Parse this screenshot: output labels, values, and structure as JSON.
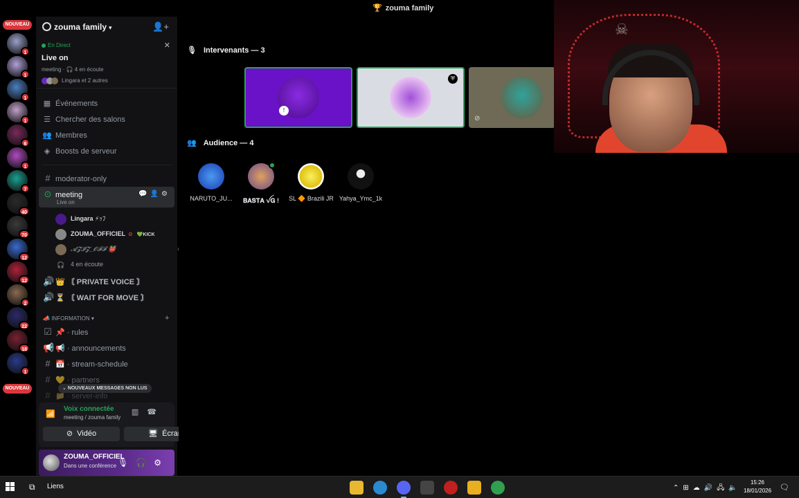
{
  "window": {
    "title": "zouma family",
    "title_icon": "trophy-icon"
  },
  "rail": {
    "top_badge": "NOUVEAU",
    "bottom_badge": "NOUVEAU",
    "servers": [
      {
        "badge": "1",
        "color": "#9aa0c8"
      },
      {
        "badge": "1",
        "color": "#b0a0d8"
      },
      {
        "badge": "1",
        "color": "#4a7fc1"
      },
      {
        "badge": "1",
        "color": "#c0a0c8"
      },
      {
        "badge": "6",
        "color": "#7a2a5a"
      },
      {
        "badge": "1",
        "color": "#b04ac0"
      },
      {
        "badge": "7",
        "color": "#1aa090"
      },
      {
        "badge": "40",
        "color": "#2a2a2a"
      },
      {
        "badge": "70",
        "color": "#3a3a3a"
      },
      {
        "badge": "12",
        "color": "#3a6ad0"
      },
      {
        "badge": "12",
        "color": "#b0203a"
      },
      {
        "badge": "2",
        "color": "#8a6a50"
      },
      {
        "badge": "22",
        "color": "#2a2a6a"
      },
      {
        "badge": "18",
        "color": "#7a2030"
      },
      {
        "badge": "1",
        "color": "#2a3a8a"
      }
    ]
  },
  "sidebar": {
    "server_name": "zouma family",
    "live": {
      "status": "En Direct",
      "title": "Live on",
      "meta": "meeting · 🎧 4 en écoute",
      "users": "Lingara et 2 autres"
    },
    "menu": [
      {
        "label": "Événements",
        "icon": "calendar-icon"
      },
      {
        "label": "Chercher des salons",
        "icon": "search-channels-icon"
      },
      {
        "label": "Membres",
        "icon": "members-icon"
      },
      {
        "label": "Boosts de serveur",
        "icon": "boost-icon"
      }
    ],
    "channels": {
      "moderator": "moderator-only",
      "meeting": "meeting",
      "meeting_sub": "Live on",
      "voice_users": [
        {
          "name": "Lingara",
          "suffix": "⚡ｯﾌ",
          "avatar": "#4a1a8a"
        },
        {
          "name": "ZOUMA_OFFICIEL",
          "tag": "KICK",
          "avatar": "#888"
        },
        {
          "name": "𝓐𝓩𝓘𝓩_𝓞𝓕𝓕",
          "suffix": "👹",
          "avatar": "#7a6a55"
        }
      ],
      "listening": "4 en écoute",
      "private_voice": "👑 〘 PRIVATE VOICE 〙",
      "wait_for_move": "⏳ 〘 WAIT FOR MOVE 〙",
      "category": "INFORMATION",
      "info_channels": [
        {
          "label": "📌 · rules"
        },
        {
          "label": "📢 · announcements"
        },
        {
          "label": "📅 · stream-schedule"
        },
        {
          "label": "💛 · partners"
        },
        {
          "label": "📁 · server-info"
        }
      ],
      "new_messages": "NOUVEAUX MESSAGES NON LUS"
    },
    "voice_panel": {
      "connected": "Voix connectée",
      "location": "meeting / zouma family",
      "video_label": "Vidéo",
      "screen_label": "Écran"
    },
    "user_panel": {
      "username": "ZOUMA_OFFICIEL",
      "status": "Dans une conférence"
    }
  },
  "stage": {
    "speakers_heading": "Intervenants — 3",
    "audience_heading": "Audience — 4",
    "audience": [
      {
        "name": "NARUTO_JU...",
        "color": "#2a5ad0"
      },
      {
        "name": "𝐁𝐀𝐒𝐓𝐀 ꪜ𝐆 !",
        "color": "#c06a30"
      },
      {
        "name": "SL 🔶 Brazili JR",
        "color": "#f0e020"
      },
      {
        "name": "Yahya_Ymc_1k",
        "color": "#222"
      }
    ]
  },
  "taskbar": {
    "links_label": "Liens",
    "time": "15:26",
    "date": "18/01/2026",
    "apps": [
      {
        "name": "file-explorer-icon",
        "color": "#e8b830"
      },
      {
        "name": "edge-icon",
        "color": "#2a8ad0"
      },
      {
        "name": "discord-icon",
        "color": "#5865f2",
        "active": true
      },
      {
        "name": "terminal-icon",
        "color": "#444"
      },
      {
        "name": "stopwatch-icon",
        "color": "#c02020"
      },
      {
        "name": "rockstar-icon",
        "color": "#e8b020"
      },
      {
        "name": "chrome-icon",
        "color": "#30a050"
      }
    ]
  }
}
